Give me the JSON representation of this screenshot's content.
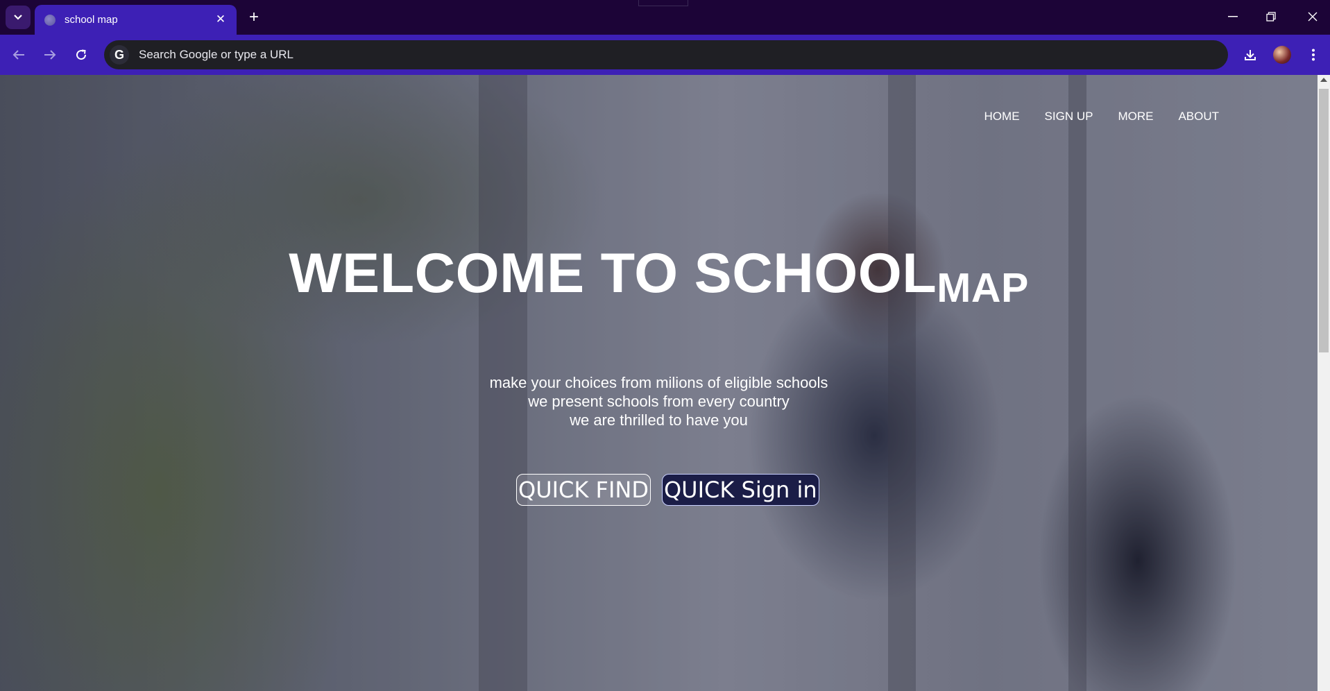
{
  "browser": {
    "tab_title": "school map",
    "tab_close_symbol": "✕",
    "new_tab_symbol": "+",
    "omnibox_placeholder": "Search Google or type a URL",
    "omnibox_icon_letter": "G",
    "accent_color": "#3d20b5",
    "titlebar_color": "#1c0437"
  },
  "page": {
    "nav": [
      "HOME",
      "SIGN UP",
      "MORE",
      "ABOUT"
    ],
    "hero_title_main": "WELCOME TO SCHOOL",
    "hero_title_sub": "MAP",
    "hero_lines": [
      "make your choices from milions of eligible schools",
      "we present schools from every country",
      "we are thrilled to have you"
    ],
    "button_find": "QUICK FIND",
    "button_signin": "QUICK Sign in"
  }
}
